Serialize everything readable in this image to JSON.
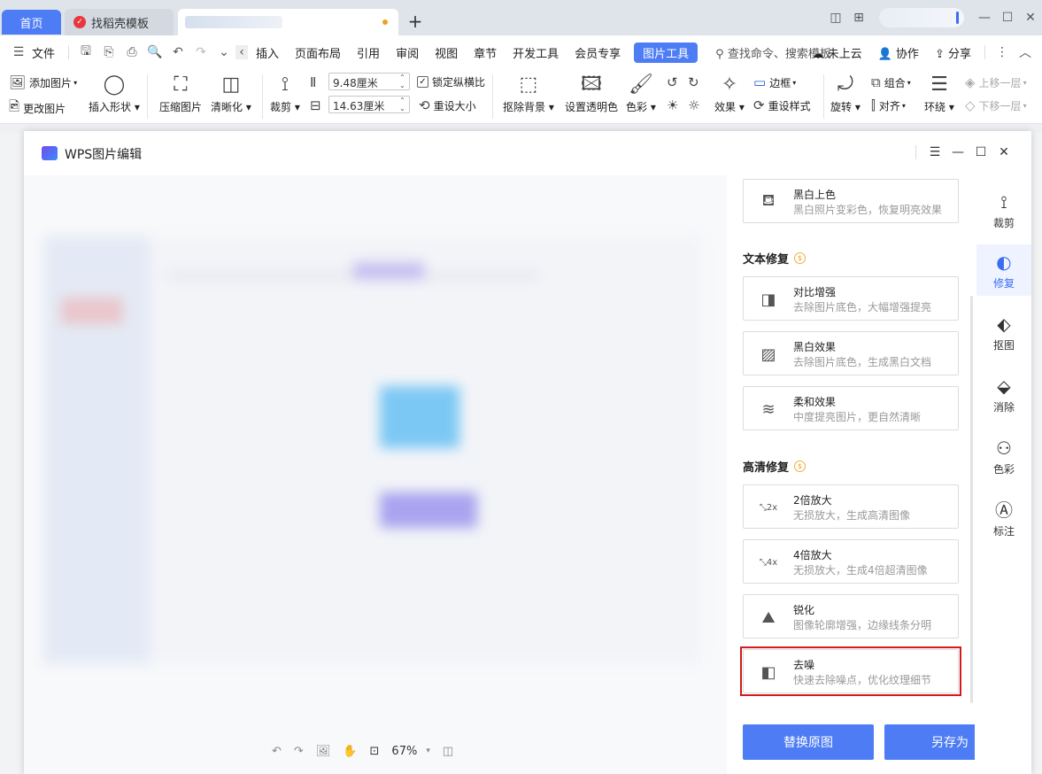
{
  "tabs": {
    "home": "首页",
    "template": "找稻壳模板",
    "add": "+"
  },
  "menu": {
    "file": "文件",
    "items": [
      "插入",
      "页面布局",
      "引用",
      "审阅",
      "视图",
      "章节",
      "开发工具",
      "会员专享"
    ],
    "active": "图片工具",
    "search": "查找命令、搜索模板",
    "cloud": "未上云",
    "collab": "协作",
    "share": "分享"
  },
  "ribbon": {
    "add_image": "添加图片",
    "change_image": "更改图片",
    "insert_shape": "插入形状",
    "compress": "压缩图片",
    "sharpen": "清晰化",
    "crop": "裁剪",
    "height": "9.48厘米",
    "width": "14.63厘米",
    "lock_ratio": "锁定纵横比",
    "reset_size": "重设大小",
    "remove_bg": "抠除背景",
    "set_transparent": "设置透明色",
    "color": "色彩",
    "effect": "效果",
    "border": "边框",
    "reset_style": "重设样式",
    "rotate": "旋转",
    "group": "组合",
    "align": "对齐",
    "wrap": "环绕",
    "bring_forward": "上移一层",
    "send_backward": "下移一层"
  },
  "dialog": {
    "title": "WPS图片编辑",
    "zoom": "67%"
  },
  "panel": {
    "top_card": {
      "title": "黑白上色",
      "desc": "黑白照片变彩色，恢复明亮效果"
    },
    "section_text": "文本修复",
    "text_cards": [
      {
        "title": "对比增强",
        "desc": "去除图片底色，大幅增强提亮"
      },
      {
        "title": "黑白效果",
        "desc": "去除图片底色，生成黑白文档"
      },
      {
        "title": "柔和效果",
        "desc": "中度提亮图片，更自然清晰"
      }
    ],
    "section_hd": "高清修复",
    "hd_cards": [
      {
        "title": "2倍放大",
        "desc": "无损放大，生成高清图像",
        "icon": "2x"
      },
      {
        "title": "4倍放大",
        "desc": "无损放大，生成4倍超清图像",
        "icon": "4x"
      },
      {
        "title": "锐化",
        "desc": "图像轮廓增强，边缘线条分明"
      },
      {
        "title": "去噪",
        "desc": "快速去除噪点，优化纹理细节"
      }
    ],
    "btn_replace": "替换原图",
    "btn_saveas": "另存为"
  },
  "rail": [
    "裁剪",
    "修复",
    "抠图",
    "消除",
    "色彩",
    "标注"
  ],
  "colors": {
    "accent": "#4d7cf5",
    "highlight": "#d41a1a",
    "coin": "#f0a020"
  }
}
